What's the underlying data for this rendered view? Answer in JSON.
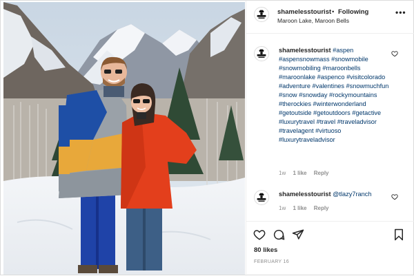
{
  "header": {
    "username": "shamelesstourist",
    "separator": "•",
    "follow_status": "Following",
    "location": "Maroon Lake, Maroon Bells",
    "more_label": "•••"
  },
  "comments": [
    {
      "username": "shamelesstourist",
      "text": "#aspen #aspensnowmass #snowmobile #snowmobiling #maroonbells #maroonlake #aspenco #visitcolorado #adventure #valentines #snowmuchfun #snow #snowday #rockymountains #therockies #winterwonderland #getoutside #getoutdoors #getactive #luxurytravel #travel #traveladvisor #travelagent #virtuoso #luxurytraveladvisor",
      "time": "1w",
      "likes": "1 like",
      "reply": "Reply"
    },
    {
      "username": "shamelesstourist",
      "text": "@tlazy7ranch",
      "time": "1w",
      "likes": "1 like",
      "reply": "Reply"
    }
  ],
  "post": {
    "likes": "80 likes",
    "date": "FEBRUARY 16"
  },
  "icons": {
    "header_avatar": "shameless-logo-icon",
    "like": "heart-icon",
    "comment": "comment-bubble-icon",
    "share": "paper-plane-icon",
    "save": "bookmark-icon"
  },
  "colors": {
    "link": "#00376b",
    "text": "#262626",
    "muted": "#8e8e8e",
    "border": "#efefef"
  },
  "photo": {
    "description_icon": "photo-icon"
  }
}
